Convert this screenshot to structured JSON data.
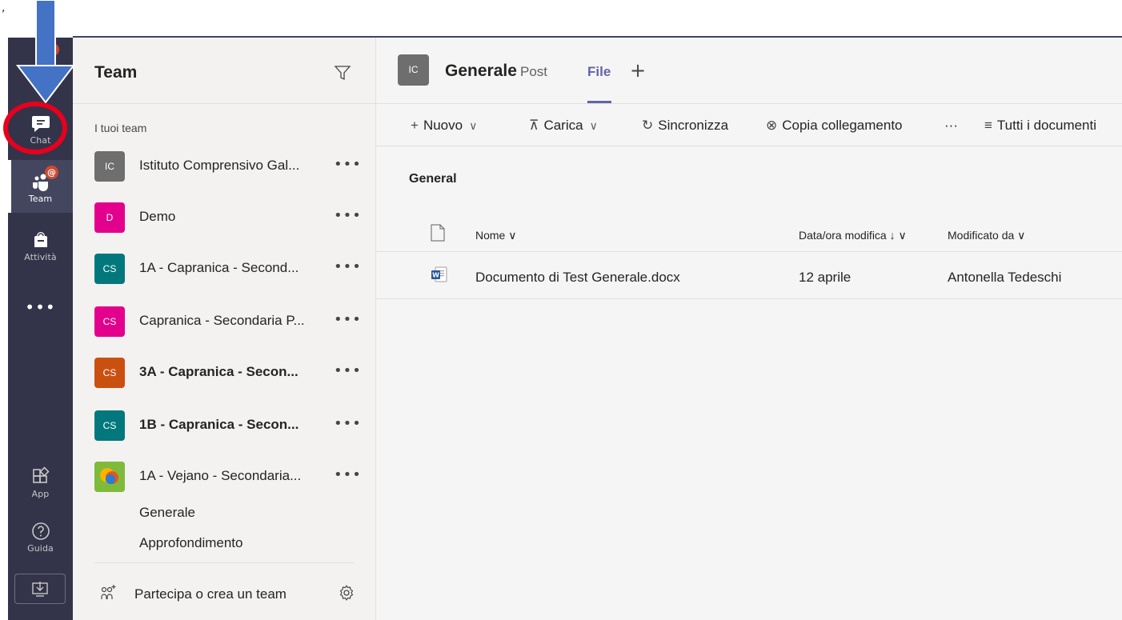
{
  "rail": {
    "items": [
      {
        "label": "Chat",
        "icon": "chat-icon"
      },
      {
        "label": "Team",
        "icon": "teams-icon",
        "badge": "@"
      },
      {
        "label": "Attività",
        "icon": "backpack-icon"
      },
      {
        "label": "App",
        "icon": "apps-icon"
      },
      {
        "label": "Guida",
        "icon": "help-icon"
      }
    ],
    "more": "•••",
    "top_badge": "",
    "colors": {
      "background": "#33344a",
      "accent": "#6264a7",
      "annotation": "#e8001c"
    }
  },
  "teams_panel": {
    "title": "Team",
    "section_label": "I tuoi team",
    "teams": [
      {
        "initials": "IC",
        "name": "Istituto Comprensivo Gal...",
        "color": "#6e6e6e",
        "bold": false
      },
      {
        "initials": "D",
        "name": "Demo",
        "color": "#e3008c",
        "bold": false
      },
      {
        "initials": "CS",
        "name": "1A - Capranica - Second...",
        "color": "#03787c",
        "bold": false
      },
      {
        "initials": "CS",
        "name": "Capranica - Secondaria P...",
        "color": "#e3008c",
        "bold": false
      },
      {
        "initials": "CS",
        "name": "3A - Capranica - Secon...",
        "color": "#ca5010",
        "bold": true
      },
      {
        "initials": "CS",
        "name": "1B - Capranica - Secon...",
        "color": "#03787c",
        "bold": true
      },
      {
        "initials": "",
        "name": "1A - Vejano - Secondaria...",
        "color": "#8cbd18",
        "bold": false
      }
    ],
    "more_label": "•••",
    "channels": [
      "Generale",
      "Approfondimento"
    ],
    "join_label": "Partecipa o crea un team"
  },
  "channel_header": {
    "avatar": "IC",
    "title": "Generale",
    "tabs": [
      {
        "label": "Post",
        "active": false
      },
      {
        "label": "File",
        "active": true
      }
    ],
    "add_tab": "+"
  },
  "toolbar": {
    "new_label": "Nuovo",
    "upload_label": "Carica",
    "sync_label": "Sincronizza",
    "copy_link_label": "Copia collegamento",
    "more_label": "···",
    "view_label": "Tutti i documenti"
  },
  "files": {
    "section_title": "General",
    "columns": [
      "Nome ∨",
      "Data/ora modifica ↓ ∨",
      "Modificato da ∨"
    ],
    "rows": [
      {
        "name": "Documento di Test Generale.docx",
        "modified": "12 aprile",
        "modified_by": "Antonella Tedeschi",
        "icon": "word-icon"
      }
    ]
  }
}
